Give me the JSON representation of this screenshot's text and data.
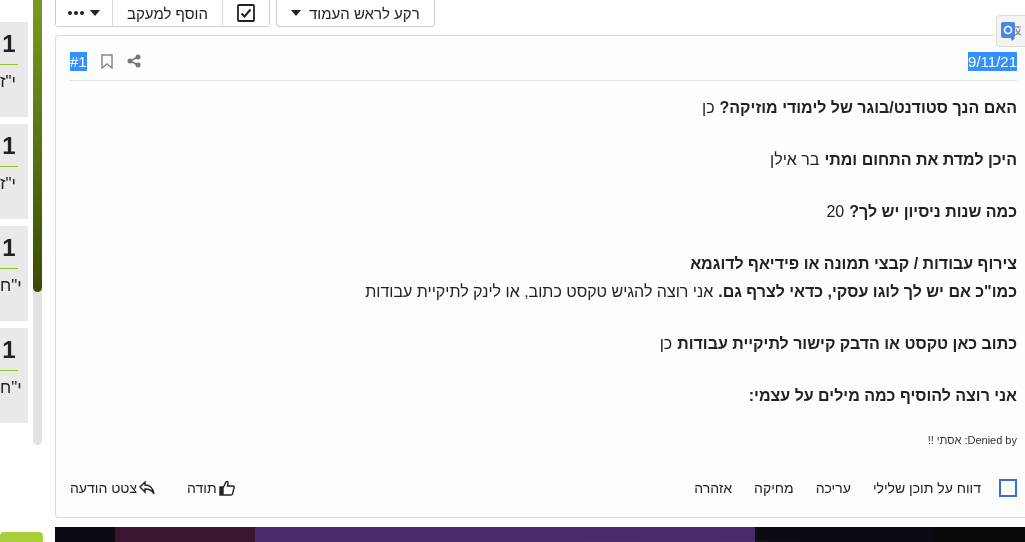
{
  "sidebar": {
    "items": [
      {
        "count": "1",
        "date": "י\"ז"
      },
      {
        "count": "1",
        "date": "י\"ז"
      },
      {
        "count": "1",
        "date": "י\"ח"
      },
      {
        "count": "1",
        "date": "י\"ח"
      }
    ]
  },
  "toolbar": {
    "buttons": [
      {
        "kind": "more"
      },
      {
        "kind": "text",
        "label": "הוסף למעקב"
      },
      {
        "kind": "check",
        "checked": true
      }
    ],
    "scroll_button": {
      "label": "רקע לראש העמוד"
    }
  },
  "post": {
    "number": {
      "text": "#1",
      "selected": true
    },
    "date": {
      "text": "9/11/21",
      "selected": true
    },
    "fields": [
      {
        "question": "האם הנך סטודנט/בוגר של לימודי מוזיקה?",
        "answer": "כן"
      },
      {
        "question": "היכן למדת את התחום ומתי",
        "answer": "בר אילן"
      },
      {
        "question": "כמה שנות ניסיון יש לך?",
        "answer": "20"
      },
      {
        "question": "צירוף עבודות / קבצי תמונה או פידיאף לדוגמא\nכמו\"כ אם יש לך לוגו עסקי, כדאי לצרף גם.",
        "answer": "אני רוצה להגיש טקסט כתוב, או לינק לתיקיית עבודות"
      },
      {
        "question": "כתוב כאן טקסט או הדבק קישור לתיקיית עבודות",
        "answer": "כן"
      },
      {
        "question": "אני רוצה להוסיף כמה מילים על עצמי:"
      }
    ],
    "moderation": "Denied by: אסתי !!",
    "report_checked": false,
    "actions": [
      "דווח על תוכן שלילי",
      "עריכה",
      "מחיקה",
      "אזהרה"
    ],
    "like": "תודה",
    "quote": "צטט הודעה"
  }
}
